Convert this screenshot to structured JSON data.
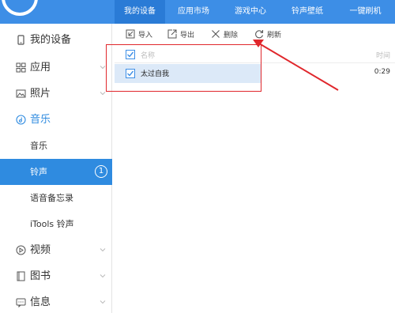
{
  "header": {
    "tabs": [
      {
        "label": "我的设备"
      },
      {
        "label": "应用市场"
      },
      {
        "label": "游戏中心"
      },
      {
        "label": "铃声壁纸"
      },
      {
        "label": "一键刷机"
      }
    ],
    "active_tab": "我的设备"
  },
  "sidebar": {
    "items": [
      {
        "label": "我的设备",
        "icon": "phone-icon"
      },
      {
        "label": "应用",
        "icon": "apps-grid-icon"
      },
      {
        "label": "照片",
        "icon": "image-icon"
      },
      {
        "label": "音乐",
        "icon": "music-icon"
      },
      {
        "label": "视频",
        "icon": "video-icon"
      },
      {
        "label": "图书",
        "icon": "book-icon"
      },
      {
        "label": "信息",
        "icon": "message-icon"
      }
    ],
    "music_subitems": [
      {
        "label": "音乐"
      },
      {
        "label": "铃声",
        "badge": "1"
      },
      {
        "label": "语音备忘录"
      },
      {
        "label": "iTools 铃声"
      }
    ]
  },
  "toolbar": {
    "import_label": "导入",
    "export_label": "导出",
    "delete_label": "删除",
    "refresh_label": "刷新"
  },
  "list": {
    "col_name": "名称",
    "col_time": "时间",
    "rows": [
      {
        "name": "太过自我",
        "time": "0:29"
      }
    ]
  },
  "colors": {
    "topbar": "#3d8ee6",
    "accent": "#2f8be0",
    "annotation": "#e0272c"
  }
}
